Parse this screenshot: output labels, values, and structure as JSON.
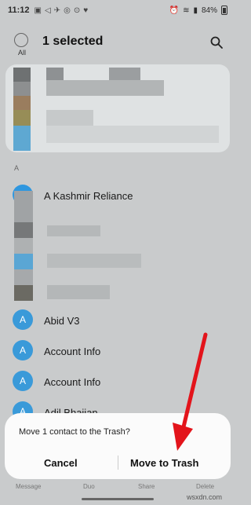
{
  "status_bar": {
    "time": "11:12",
    "notifications": [
      "▣",
      "◁",
      "✈",
      "◎",
      "⊙",
      "♥"
    ],
    "battery_text": "84%"
  },
  "header": {
    "all_label": "All",
    "title": "1 selected",
    "search_icon": "search-icon"
  },
  "section_letter": "A",
  "contacts": [
    {
      "initial": "",
      "name": "A Kashmir Reliance",
      "selected": true
    },
    {
      "initial": "A",
      "name": "Abid V3",
      "selected": false
    },
    {
      "initial": "A",
      "name": "Account Info",
      "selected": false
    },
    {
      "initial": "A",
      "name": "Account Info",
      "selected": false
    },
    {
      "initial": "A",
      "name": "Adil Bhaijan",
      "selected": false
    }
  ],
  "dialog": {
    "message": "Move 1 contact to the Trash?",
    "cancel_label": "Cancel",
    "confirm_label": "Move to Trash"
  },
  "bottom_nav": [
    "Message",
    "Duo",
    "Share",
    "Delete"
  ],
  "watermark": "wsxdn.com",
  "colors": {
    "accent": "#2f97df",
    "arrow": "#e3141b"
  }
}
